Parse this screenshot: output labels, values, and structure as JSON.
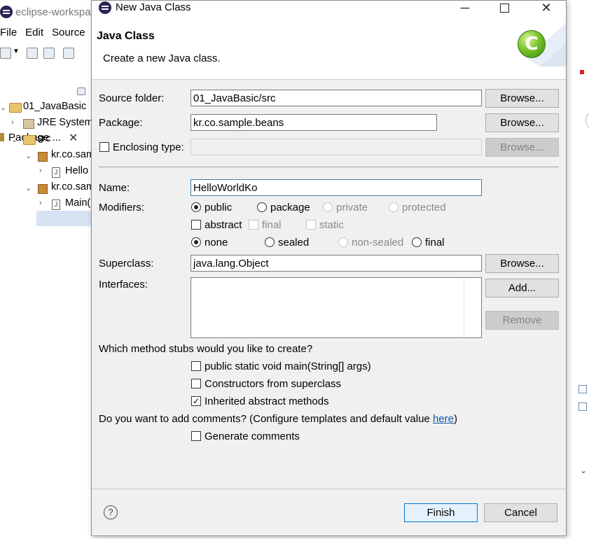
{
  "background_window": {
    "title": "eclipse-workspa",
    "menu": [
      "File",
      "Edit",
      "Source"
    ],
    "explorer_tab": "Package ...",
    "explorer_close": "✕",
    "tree": [
      {
        "label": "01_JavaBasic"
      },
      {
        "label": "JRE System"
      },
      {
        "label": "src"
      },
      {
        "label": "kr.co.sam"
      },
      {
        "label": "Hello"
      },
      {
        "label": "kr.co.sam"
      },
      {
        "label": "Main("
      }
    ]
  },
  "dialog": {
    "title": "New Java Class",
    "banner_title": "Java Class",
    "banner_description": "Create a new Java class.",
    "banner_icon_letter": "C",
    "source_folder": {
      "label": "Source folder:",
      "value": "01_JavaBasic/src",
      "browse": "Browse..."
    },
    "package": {
      "label": "Package:",
      "value": "kr.co.sample.beans",
      "browse": "Browse..."
    },
    "enclosing": {
      "label": "Enclosing type:",
      "value": "",
      "browse": "Browse...",
      "checked": false
    },
    "name": {
      "label": "Name:",
      "value": "HelloWorldKo"
    },
    "modifiers": {
      "label": "Modifiers:",
      "access": [
        {
          "label": "public",
          "selected": true,
          "enabled": true
        },
        {
          "label": "package",
          "selected": false,
          "enabled": true
        },
        {
          "label": "private",
          "selected": false,
          "enabled": false
        },
        {
          "label": "protected",
          "selected": false,
          "enabled": false
        }
      ],
      "flags": [
        {
          "label": "abstract",
          "checked": false,
          "enabled": true
        },
        {
          "label": "final",
          "checked": false,
          "enabled": false
        },
        {
          "label": "static",
          "checked": false,
          "enabled": false
        }
      ],
      "sealing": [
        {
          "label": "none",
          "selected": true,
          "enabled": true
        },
        {
          "label": "sealed",
          "selected": false,
          "enabled": true
        },
        {
          "label": "non-sealed",
          "selected": false,
          "enabled": false
        },
        {
          "label": "final",
          "selected": false,
          "enabled": true
        }
      ]
    },
    "superclass": {
      "label": "Superclass:",
      "value": "java.lang.Object",
      "browse": "Browse..."
    },
    "interfaces": {
      "label": "Interfaces:",
      "add": "Add...",
      "remove": "Remove"
    },
    "stubs_question": "Which method stubs would you like to create?",
    "stubs": [
      {
        "label": "public static void main(String[] args)",
        "checked": false
      },
      {
        "label": "Constructors from superclass",
        "checked": false
      },
      {
        "label": "Inherited abstract methods",
        "checked": true
      }
    ],
    "comments_question": "Do you want to add comments? (Configure templates and default value ",
    "comments_link": "here",
    "comments_close": ")",
    "generate_comments": {
      "label": "Generate comments",
      "checked": false
    },
    "help": "?",
    "finish": "Finish",
    "cancel": "Cancel"
  },
  "colors": {
    "accent": "#0078d7",
    "link": "#0b58a0",
    "dialog_bg": "#f0f0f0"
  }
}
